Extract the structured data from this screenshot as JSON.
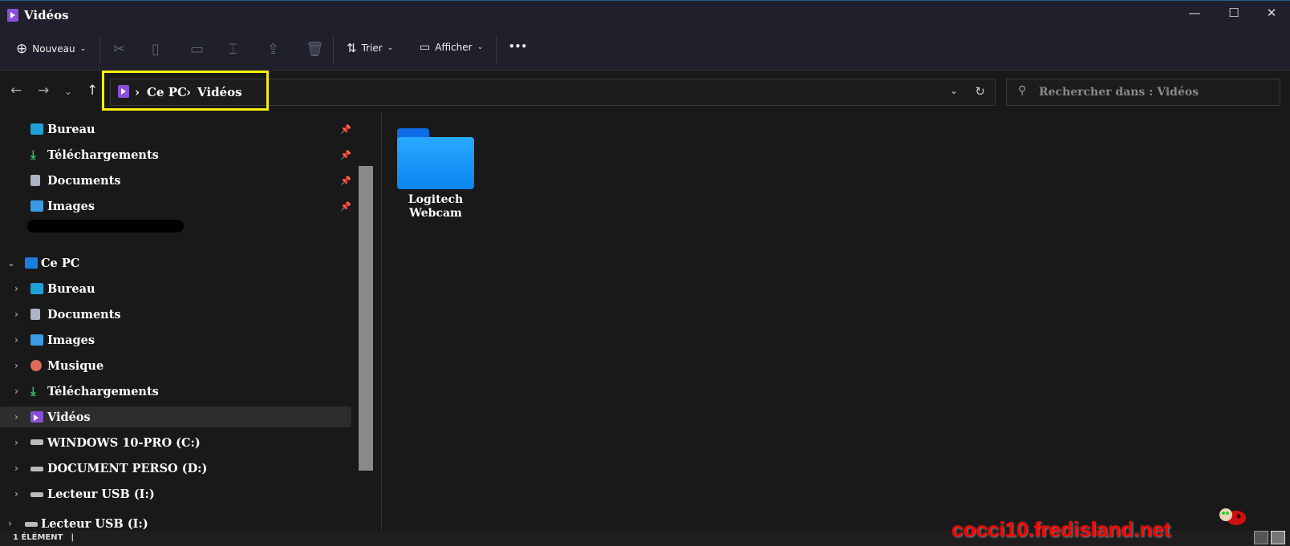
{
  "window": {
    "title": "Vidéos",
    "icon": "videos-icon"
  },
  "toolbar": {
    "new_label": "Nouveau",
    "sort_label": "Trier",
    "view_label": "Afficher",
    "more_label": "•••",
    "icons": [
      "cut-icon",
      "copy-icon",
      "paste-icon",
      "rename-icon",
      "share-icon",
      "delete-icon"
    ]
  },
  "address": {
    "crumbs": [
      "Ce PC",
      "Vidéos"
    ],
    "separator": "›"
  },
  "search": {
    "placeholder": "Rechercher dans : Vidéos"
  },
  "sidebar": {
    "quick_access": [
      {
        "label": "Bureau",
        "icon": "desktop-icon",
        "pinned": true
      },
      {
        "label": "Téléchargements",
        "icon": "download-icon",
        "pinned": true
      },
      {
        "label": "Documents",
        "icon": "documents-icon",
        "pinned": true
      },
      {
        "label": "Images",
        "icon": "pictures-icon",
        "pinned": true
      }
    ],
    "this_pc": {
      "label": "Ce PC",
      "expanded": true
    },
    "items": [
      {
        "label": "Bureau",
        "icon": "desktop-icon"
      },
      {
        "label": "Documents",
        "icon": "documents-icon"
      },
      {
        "label": "Images",
        "icon": "pictures-icon"
      },
      {
        "label": "Musique",
        "icon": "music-icon"
      },
      {
        "label": "Téléchargements",
        "icon": "download-icon"
      },
      {
        "label": "Vidéos",
        "icon": "videos-icon",
        "selected": true
      },
      {
        "label": "WINDOWS 10-PRO (C:)",
        "icon": "drive-icon"
      },
      {
        "label": "DOCUMENT PERSO (D:)",
        "icon": "drive-icon"
      },
      {
        "label": "Lecteur USB (I:)",
        "icon": "usb-drive-icon"
      }
    ],
    "extra": {
      "label": "Lecteur USB (I:)",
      "icon": "usb-drive-icon"
    }
  },
  "content": {
    "items": [
      {
        "name": "Logitech Webcam",
        "type": "folder"
      }
    ]
  },
  "status": {
    "count": "1 ÉLÉMENT"
  },
  "watermark": {
    "text": "cocci10.fredisland.net"
  }
}
